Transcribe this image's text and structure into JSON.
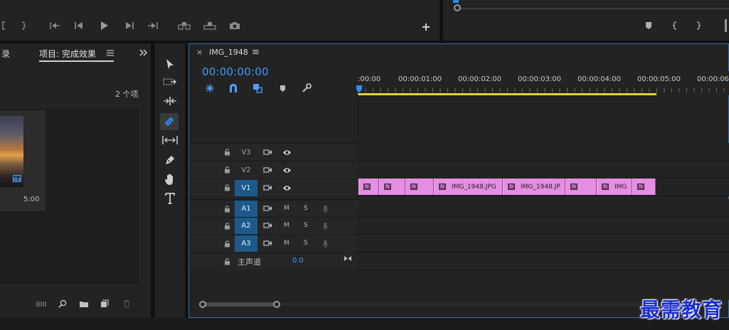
{
  "source_monitor": {
    "transport_icons": [
      "mark-in-icon",
      "mark-out-icon",
      "go-to-in-icon",
      "step-back-icon",
      "play-icon",
      "step-forward-icon",
      "go-to-out-icon",
      "insert-icon",
      "overwrite-icon",
      "export-frame-icon",
      "add-button-icon"
    ]
  },
  "program_monitor": {
    "icons": [
      "add-marker-icon",
      "mark-in-icon",
      "mark-out-icon"
    ]
  },
  "project_panel": {
    "left_tab_partial": "录",
    "tab_label": "项目: 完成效果",
    "item_count": "2 个项",
    "thumbnail_duration": "5:00",
    "bottom_icons": [
      "list-view-icon",
      "find-icon",
      "new-bin-icon",
      "new-item-icon",
      "trash-icon"
    ]
  },
  "tools": [
    "selection-tool-icon",
    "track-select-tool-icon",
    "ripple-edit-tool-icon",
    "razor-tool-icon",
    "slip-tool-icon",
    "pen-tool-icon",
    "hand-tool-icon",
    "type-tool-icon"
  ],
  "timeline": {
    "sequence_name": "IMG_1948",
    "close_glyph": "×",
    "menu_glyph": "≡",
    "timecode": "00:00:00:00",
    "ruler_labels": [
      ":00:00",
      "00:00:01:00",
      "00:00:02:00",
      "00:00:03:00",
      "00:00:04:00",
      "00:00:05:00",
      "00:00:06:"
    ],
    "tracks": {
      "v3": "V3",
      "v2": "V2",
      "v1": "V1",
      "a1": "A1",
      "a2": "A2",
      "a3": "A3",
      "m": "M",
      "s": "S"
    },
    "master_label": "主声道",
    "master_value": "0.0",
    "clips": [
      {
        "label": ""
      },
      {
        "label": ""
      },
      {
        "label": ""
      },
      {
        "label": "IMG_1948.JPG"
      },
      {
        "label": "IMG_1948.JP"
      },
      {
        "label": ""
      },
      {
        "label": "IMG"
      },
      {
        "label": ""
      }
    ],
    "colors": {
      "clip": "#e58fe3",
      "playhead": "#2d8ceb",
      "work_area": "#e6d22b",
      "target_on": "#1d5a8c"
    }
  },
  "watermark": "最需教育"
}
